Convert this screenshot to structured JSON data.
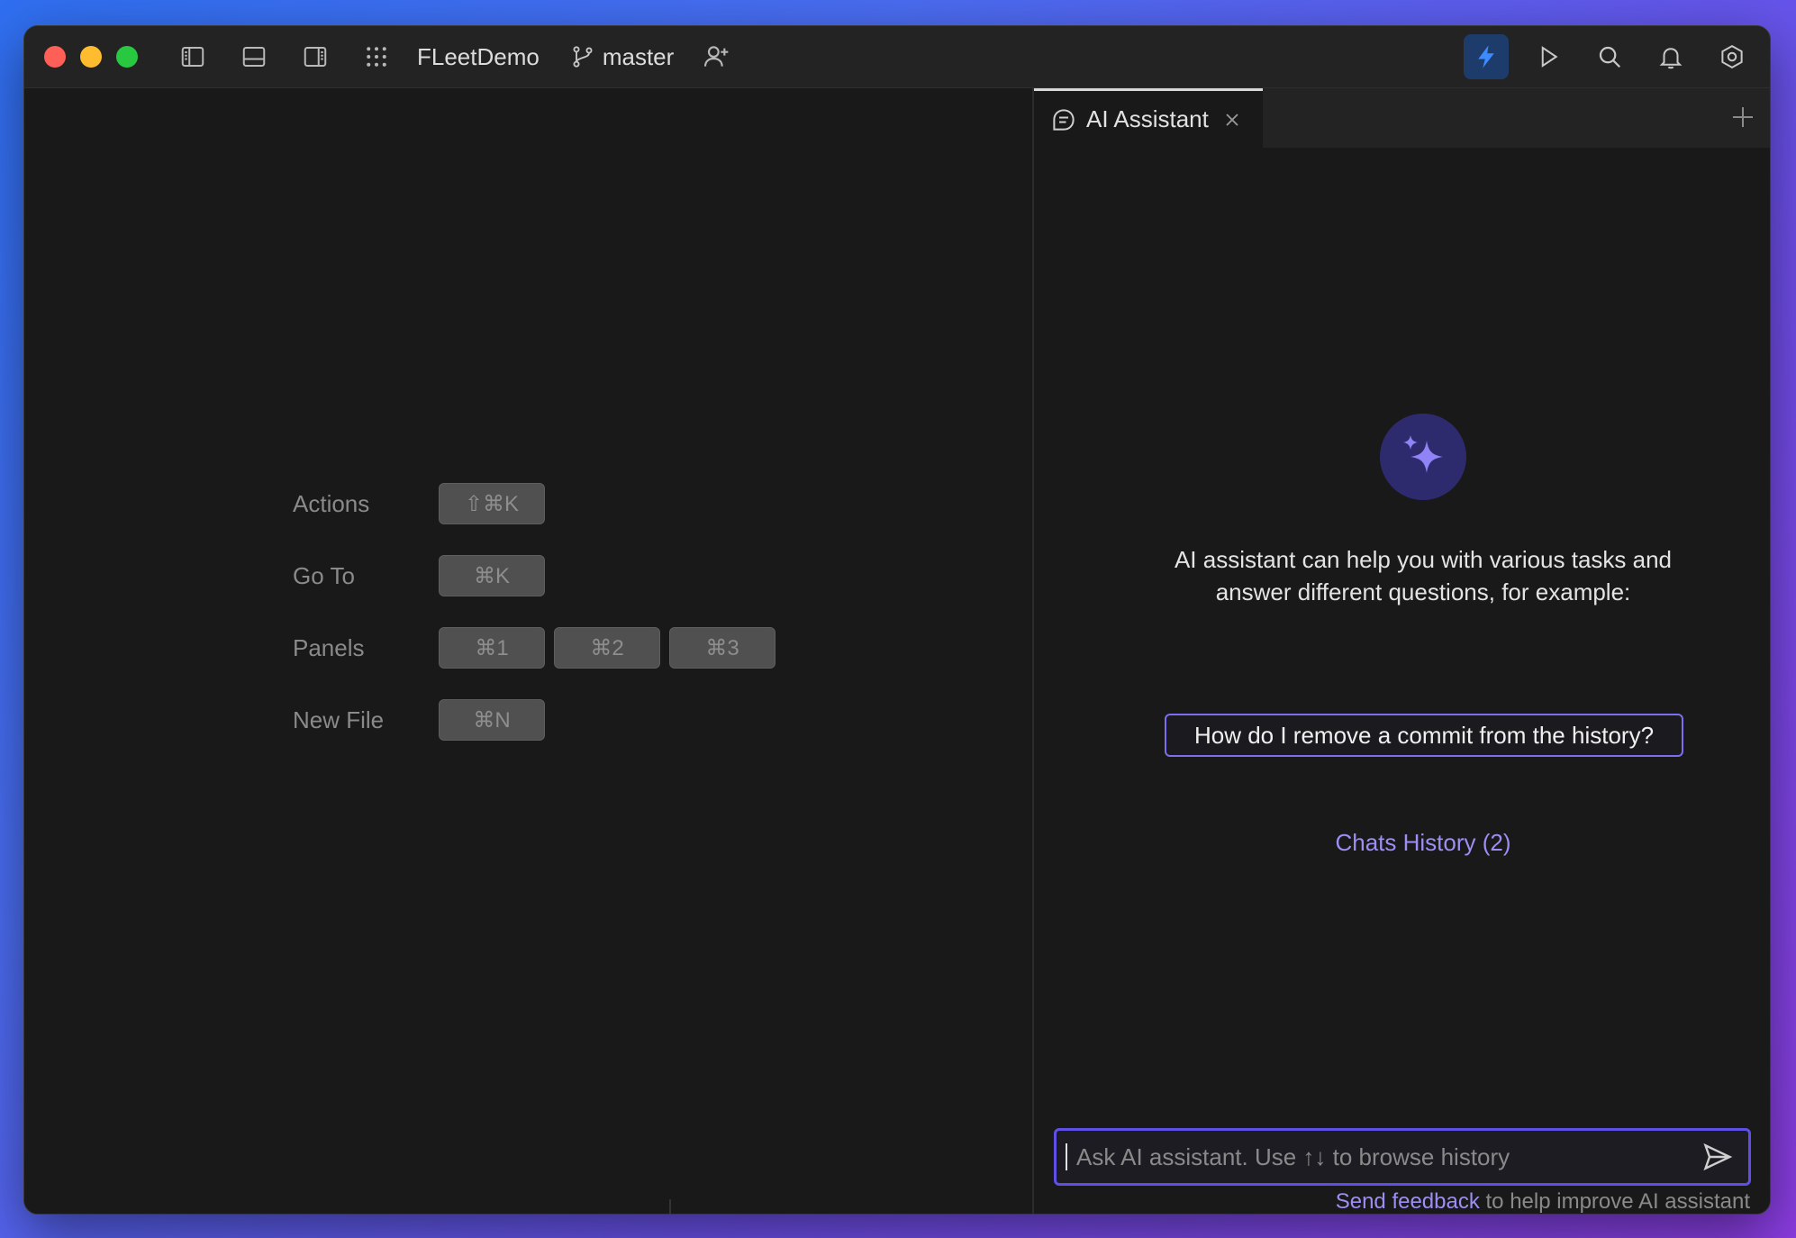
{
  "titlebar": {
    "project_name": "FLeetDemo",
    "branch_name": "master"
  },
  "shortcuts": [
    {
      "label": "Actions",
      "keys": [
        "⇧⌘K"
      ]
    },
    {
      "label": "Go To",
      "keys": [
        "⌘K"
      ]
    },
    {
      "label": "Panels",
      "keys": [
        "⌘1",
        "⌘2",
        "⌘3"
      ]
    },
    {
      "label": "New File",
      "keys": [
        "⌘N"
      ]
    }
  ],
  "assistant": {
    "tab_label": "AI Assistant",
    "intro_text": "AI assistant can help you with various tasks and answer different questions, for example:",
    "suggestion": "How do I remove a commit from the history?",
    "history_link": "Chats History (2)",
    "input_placeholder": "Ask AI assistant. Use ↑↓ to browse history",
    "feedback_link": "Send feedback",
    "feedback_text": " to help improve AI assistant"
  },
  "colors": {
    "accent": "#7a6ff0",
    "link": "#9b8ef5",
    "bolt_bg": "#1d3c6b",
    "bolt": "#3d8cff"
  }
}
